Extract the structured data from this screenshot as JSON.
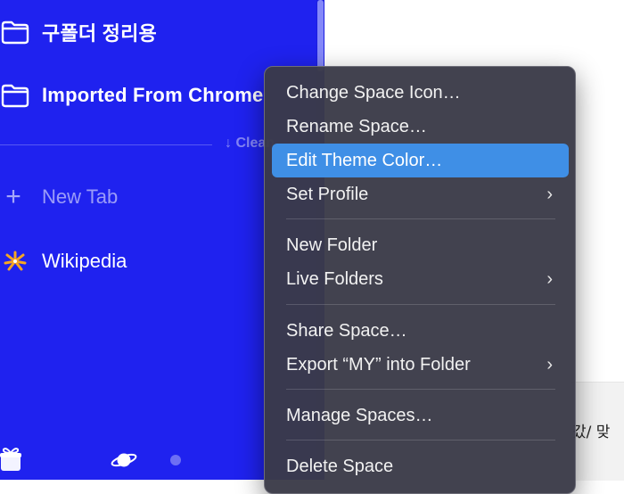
{
  "sidebar": {
    "folders": [
      {
        "label": "구폴더 정리용",
        "icon": "folder-icon"
      },
      {
        "label": "Imported From Chrome",
        "icon": "folder-icon"
      }
    ],
    "clean_button": "↓ Clean",
    "new_tab": "New Tab",
    "tabs": [
      {
        "label": "Wikipedia",
        "icon": "wikipedia-favicon-icon"
      }
    ],
    "bottom_icons": [
      "gift-icon",
      "planet-icon",
      "space-dot-icon"
    ],
    "background_color": "#1f22ef"
  },
  "context_menu": {
    "items": [
      {
        "label": "Change Space Icon…",
        "submenu": false
      },
      {
        "label": "Rename Space…",
        "submenu": false
      },
      {
        "label": "Edit Theme Color…",
        "submenu": false,
        "highlighted": true
      },
      {
        "label": "Set Profile",
        "submenu": true
      },
      {
        "label": "New Folder",
        "submenu": false
      },
      {
        "label": "Live Folders",
        "submenu": true
      },
      {
        "label": "Share Space…",
        "submenu": false
      },
      {
        "label": "Export “MY” into Folder",
        "submenu": true
      },
      {
        "label": "Manage Spaces…",
        "submenu": false
      },
      {
        "label": "Delete Space",
        "submenu": false
      }
    ],
    "highlight_color": "#3f8fe6"
  },
  "content": {
    "partial_text": "갔/ 맞"
  }
}
